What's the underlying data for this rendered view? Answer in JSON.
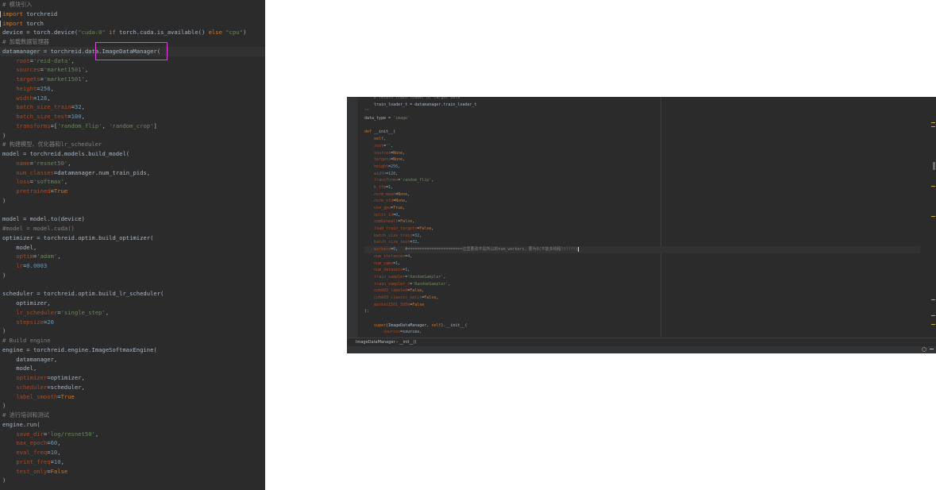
{
  "left_editor": {
    "lines": [
      "# 模块引入",
      "import torchreid",
      "import torch",
      "device = torch.device(\"cuda:0\" if torch.cuda.is_available() else \"cpu\")",
      "# 加载数据管理器",
      "datamanager = torchreid.data.ImageDataManager(",
      "    root='reid-data',",
      "    sources='market1501',",
      "    targets='market1501',",
      "    height=256,",
      "    width=128,",
      "    batch_size_train=32,",
      "    batch_size_test=100,",
      "    transforms=['random_flip', 'random_crop']",
      ")",
      "# 构建模型、优化器和lr_scheduler",
      "model = torchreid.models.build_model(",
      "    name='resnet50',",
      "    num_classes=datamanager.num_train_pids,",
      "    loss='softmax',",
      "    pretrained=True",
      ")",
      "",
      "model = model.to(device)",
      "#model = model.cuda()",
      "optimizer = torchreid.optim.build_optimizer(",
      "    model,",
      "    optim='adam',",
      "    lr=0.0003",
      ")",
      "",
      "scheduler = torchreid.optim.build_lr_scheduler(",
      "    optimizer,",
      "    lr_scheduler='single_step',",
      "    stepsize=20",
      ")",
      "# Build engine",
      "engine = torchreid.engine.ImageSoftmaxEngine(",
      "    datamanager,",
      "    model,",
      "    optimizer=optimizer,",
      "    scheduler=scheduler,",
      "    label_smooth=True",
      ")",
      "# 进行培训和测试",
      "engine.run(",
      "    save_dir='log/resnet50',",
      "    max_epoch=60,",
      "    eval_freq=10,",
      "    print_freq=10,",
      "    test_only=False",
      ")"
    ],
    "current_line": 5,
    "highlighted_token": "ImageDataManager("
  },
  "right_editor": {
    "lines": [
      "    # return train loader of target data",
      "    train_loader_t = datamanager.train_loader_t",
      "\"\"\"",
      "data_type = 'image'",
      "",
      "def __init__(",
      "    self,",
      "    root='',",
      "    sources=None,",
      "    targets=None,",
      "    height=256,",
      "    width=128,",
      "    transforms='random_flip',",
      "    k_tfm=1,",
      "    norm_mean=None,",
      "    norm_std=None,",
      "    use_gpu=True,",
      "    split_id=0,",
      "    combineall=False,",
      "    load_train_targets=False,",
      "    batch_size_train=32,",
      "    batch_size_test=32,",
      "    workers=0,   #=======================这里要改不是所以的num_workers，要为0(不能多线程!!!!!!)",
      "    num_instances=4,",
      "    num_cams=1,",
      "    num_datasets=1,",
      "    train_sampler='RandomSampler',",
      "    train_sampler_t='RandomSampler',",
      "    cuhk03_labeled=False,",
      "    cuhk03_classic_split=False,",
      "    market1501_500k=False",
      "):",
      "",
      "    super(ImageDataManager, self).__init__(",
      "        sources=sources,"
    ],
    "current_line": 22,
    "breadcrumb": "ImageDataManager  ›  __init__()",
    "scroll_marker_colors": [
      "#d6a32a",
      "#d6a32a",
      "#6b6b6b",
      "#d6a32a",
      "#d6a32a",
      "#d6a32a",
      "#d6a32a",
      "#d6a32a"
    ]
  },
  "colors": {
    "editor_bg": "#2b2b2b",
    "keyword": "#cc7832",
    "string": "#6a8759",
    "number": "#6897bb",
    "comment": "#808080",
    "param": "#aa4926",
    "highlight_box": "#e040e0"
  }
}
